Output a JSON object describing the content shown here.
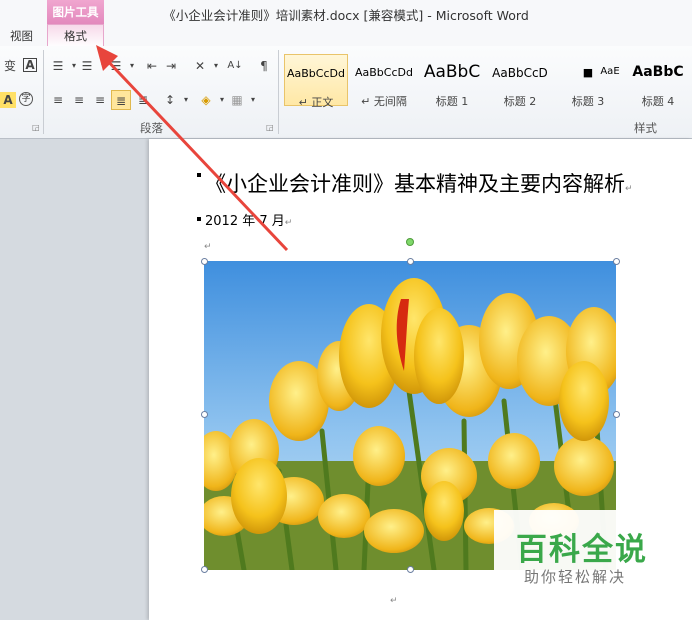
{
  "window": {
    "title": "《小企业会计准则》培训素材.docx [兼容模式] - Microsoft Word"
  },
  "context_tab_group": {
    "label": "图片工具"
  },
  "tabs": [
    {
      "label": "视图"
    },
    {
      "label": "格式"
    }
  ],
  "ribbon": {
    "paragraph_group_label": "段落",
    "styles_group_label": "样式",
    "font_partial": {
      "icons": [
        "phonetic-guide-icon",
        "character-border-icon",
        "highlight-a-icon",
        "enclosed-character-icon"
      ],
      "char_a1": "A",
      "char_a2": "A",
      "char_enclosed": "字",
      "char_phonetic": "变"
    },
    "paragraph_icons": [
      "bullets-icon",
      "numbering-icon",
      "multilevel-list-icon",
      "decrease-indent-icon",
      "increase-indent-icon",
      "asian-layout-icon",
      "sort-icon",
      "show-marks-icon",
      "align-left-icon",
      "align-center-icon",
      "align-right-icon",
      "justify-icon",
      "distributed-icon",
      "line-spacing-icon",
      "shading-icon",
      "border-icon"
    ],
    "styles": [
      {
        "sample": "AaBbCcDd",
        "name": "↵ 正文",
        "selected": true
      },
      {
        "sample": "AaBbCcDd",
        "name": "↵ 无间隔",
        "selected": false
      },
      {
        "sample": "AaBbC",
        "name": "标题 1",
        "selected": false
      },
      {
        "sample": "AaBbCcD",
        "name": "标题 2",
        "selected": false
      },
      {
        "sample": "■",
        "name": "标题 3",
        "selected": false
      },
      {
        "sample": "AaE",
        "name": "",
        "selected": false
      },
      {
        "sample": "AaBbC",
        "name": "标题 4",
        "selected": false
      }
    ]
  },
  "document": {
    "title": "《小企业会计准则》基本精神及主要内容解析",
    "date": "2012 年 7 月",
    "paragraph_mark": "↵"
  },
  "annotation": {
    "arrow_color": "#e8453c"
  },
  "watermark": {
    "title": "百科全说",
    "subtitle": "助你轻松解决"
  }
}
